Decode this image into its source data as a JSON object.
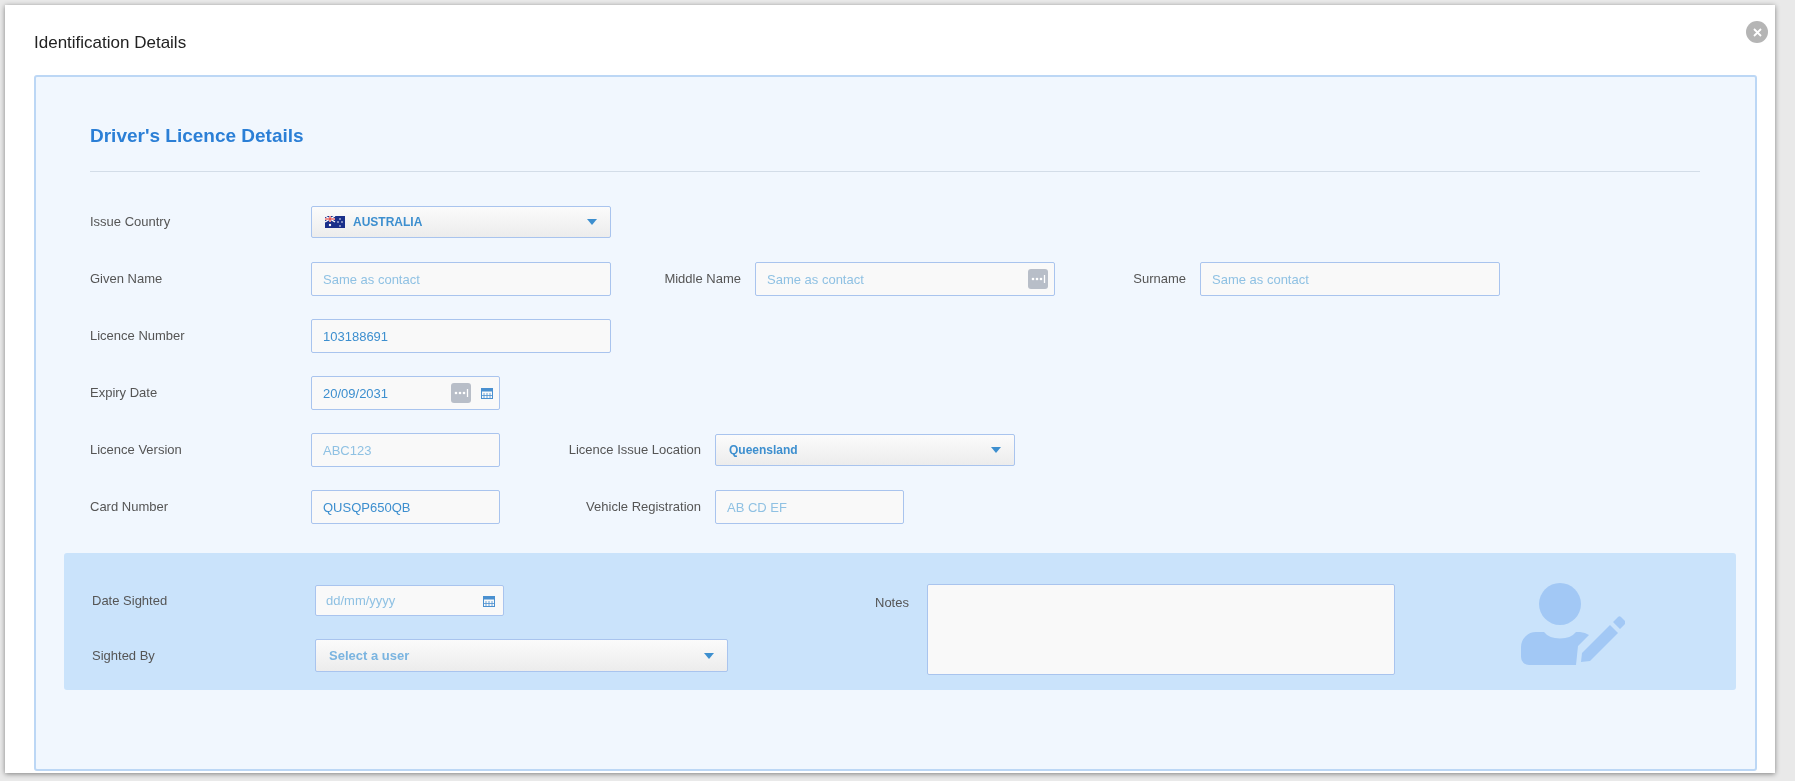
{
  "dialog": {
    "title": "Identification Details"
  },
  "section": {
    "heading": "Driver's Licence Details"
  },
  "rows": [
    [
      {
        "label": "Issue Country",
        "kind": "select",
        "value": "AUSTRALIA",
        "flag": true
      }
    ],
    [
      {
        "label": "Given Name",
        "kind": "input",
        "placeholder": "Same as contact",
        "autofill_icon": false
      },
      {
        "label": "Middle Name",
        "kind": "input",
        "placeholder": "Same as contact",
        "autofill_icon": true
      },
      {
        "label": "Surname",
        "kind": "input",
        "placeholder": "Same as contact",
        "autofill_icon": false
      }
    ],
    [
      {
        "label": "Licence Number",
        "kind": "input",
        "value": "103188691",
        "autofill_icon": false
      }
    ],
    [
      {
        "label": "Expiry Date",
        "kind": "date",
        "value": "20/09/2031",
        "autofill_icon": true
      }
    ],
    [
      {
        "label": "Licence Version",
        "kind": "input",
        "placeholder": "ABC123",
        "autofill_icon": false
      },
      {
        "label": "Licence Issue Location",
        "kind": "select",
        "value": "Queensland",
        "flag": false
      }
    ],
    [
      {
        "label": "Card Number",
        "kind": "input",
        "value": "QUSQP650QB",
        "autofill_icon": false
      },
      {
        "label": "Vehicle Registration",
        "kind": "input",
        "placeholder": "AB CD EF",
        "autofill_icon": false
      }
    ]
  ],
  "sighting": {
    "date_sighted": {
      "label": "Date Sighted",
      "placeholder": "dd/mm/yyyy"
    },
    "sighted_by": {
      "label": "Sighted By",
      "placeholder": "Select a user"
    },
    "notes": {
      "label": "Notes"
    }
  }
}
